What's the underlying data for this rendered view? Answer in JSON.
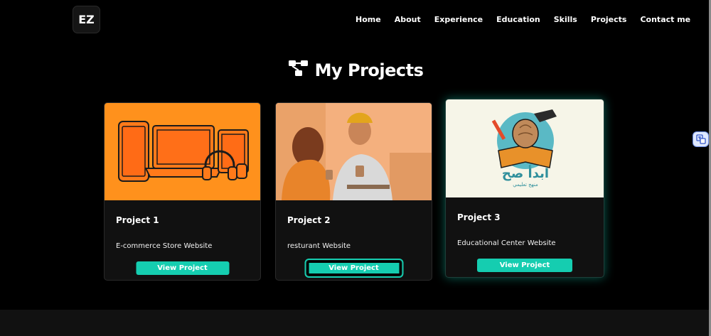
{
  "header": {
    "logo": "EZ",
    "nav": [
      "Home",
      "About",
      "Experience",
      "Education",
      "Skills",
      "Projects",
      "Contact me"
    ]
  },
  "section": {
    "title": "My Projects",
    "icon": "sitemap-icon"
  },
  "projects": [
    {
      "title": "Project 1",
      "description": "E-commerce Store Website",
      "button": "View Project",
      "image": "devices-illustration"
    },
    {
      "title": "Project 2",
      "description": "resturant Website",
      "button": "View Project",
      "image": "cafe-couple-photo"
    },
    {
      "title": "Project 3",
      "description": "Educational Center Website",
      "button": "View Project",
      "image": "education-logo",
      "logo_text": "ابدأ صح",
      "logo_subtext": "منهج تعليمي"
    }
  ],
  "colors": {
    "accent": "#15cdb0",
    "background": "#000000",
    "card": "#111111"
  },
  "overlay": {
    "translate_icon": "translate-icon"
  }
}
